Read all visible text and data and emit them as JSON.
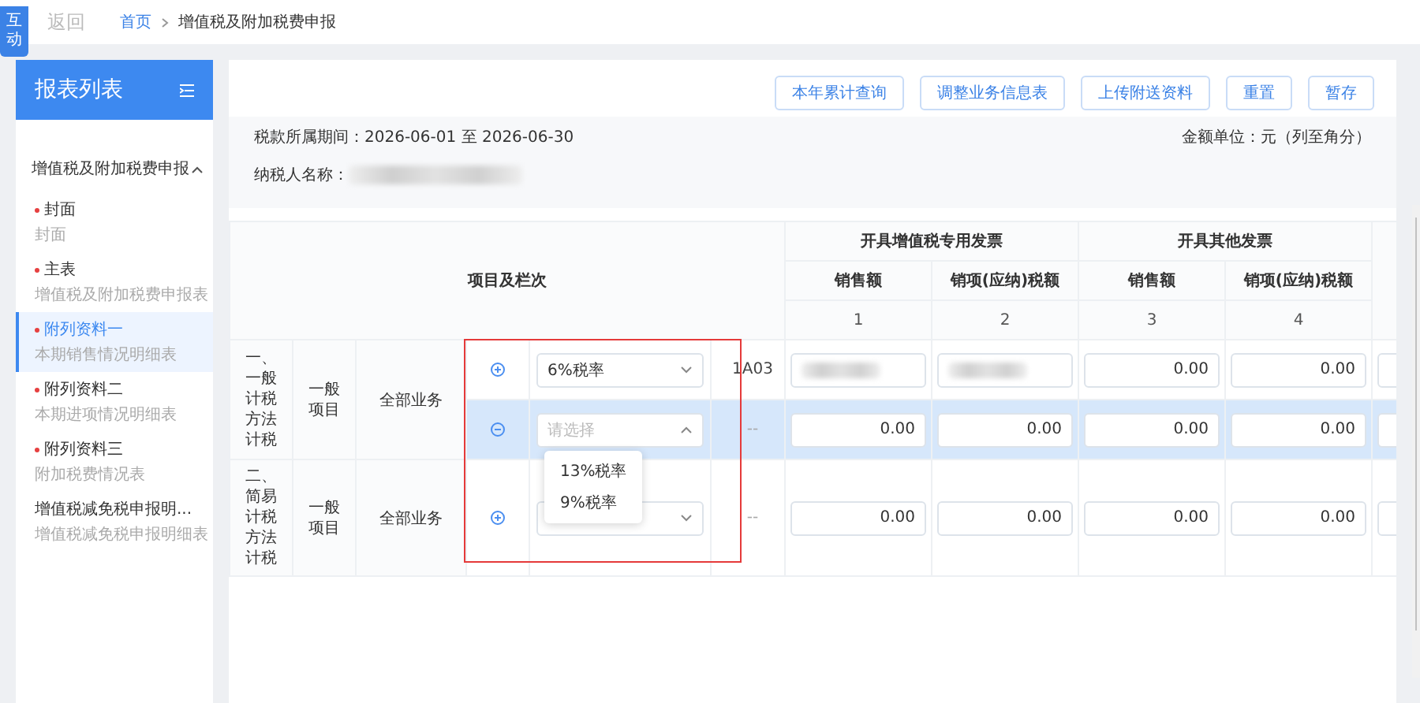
{
  "top_bar": {
    "badge": "互动",
    "back": "返回",
    "breadcrumb": [
      {
        "label": "首页",
        "link": true
      },
      {
        "label": "增值税及附加税费申报",
        "link": false
      }
    ]
  },
  "sidebar": {
    "title": "报表列表",
    "group": {
      "label": "增值税及附加税费申报",
      "expanded": true
    },
    "items": [
      {
        "title": "封面",
        "subtitle": "封面",
        "required": true,
        "selected": false
      },
      {
        "title": "主表",
        "subtitle": "增值税及附加税费申报表",
        "required": true,
        "selected": false
      },
      {
        "title": "附列资料一",
        "subtitle": "本期销售情况明细表",
        "required": true,
        "selected": true
      },
      {
        "title": "附列资料二",
        "subtitle": "本期进项情况明细表",
        "required": true,
        "selected": false
      },
      {
        "title": "附列资料三",
        "subtitle": "附加税费情况表",
        "required": true,
        "selected": false
      },
      {
        "title": "增值税减免税申报明...",
        "subtitle": "增值税减免税申报明细表",
        "required": false,
        "selected": false
      }
    ]
  },
  "toolbar": {
    "buttons": [
      "本年累计查询",
      "调整业务信息表",
      "上传附送资料",
      "重置",
      "暂存"
    ]
  },
  "info": {
    "period": "税款所属期间：2026-06-01 至 2026-06-30",
    "taxpayer_label": "纳税人名称：",
    "taxpayer_blurred": true,
    "unit": "金额单位：元（列至角分）"
  },
  "table": {
    "corner": "项目及栏次",
    "groups": [
      {
        "label": "开具增值税专用发票",
        "columns": [
          {
            "label": "销售额",
            "number": "1"
          },
          {
            "label": "销项(应纳)税额",
            "number": "2"
          }
        ]
      },
      {
        "label": "开具其他发票",
        "columns": [
          {
            "label": "销售额",
            "number": "3"
          },
          {
            "label": "销项(应纳)税额",
            "number": "4"
          }
        ]
      }
    ],
    "sections": [
      {
        "label": "一、一般计税方法计税",
        "item": "一般项目",
        "business": "全部业务",
        "rows": [
          {
            "kind": "add",
            "highlighted": false,
            "rate": {
              "value": "6%税率",
              "open": false
            },
            "code": "1A03",
            "cells": [
              {
                "blurred": true
              },
              {
                "blurred": true
              },
              {
                "value": "0.00",
                "blurred": false
              },
              {
                "value": "0.00",
                "blurred": false
              }
            ]
          },
          {
            "kind": "remove",
            "highlighted": true,
            "rate": {
              "placeholder": "请选择",
              "open": true
            },
            "code": "--",
            "cells": [
              {
                "value": "0.00",
                "blurred": false
              },
              {
                "value": "0.00",
                "blurred": false
              },
              {
                "value": "0.00",
                "blurred": false
              },
              {
                "value": "0.00",
                "blurred": false
              }
            ]
          }
        ]
      },
      {
        "label": "二、简易计税方法计税",
        "item": "一般项目",
        "business": "全部业务",
        "rows": [
          {
            "kind": "add",
            "highlighted": false,
            "rate": {
              "open": false
            },
            "code": "--",
            "cells": [
              {
                "value": "0.00",
                "blurred": false
              },
              {
                "value": "0.00",
                "blurred": false
              },
              {
                "value": "0.00",
                "blurred": false
              },
              {
                "value": "0.00",
                "blurred": false
              }
            ]
          }
        ]
      }
    ]
  },
  "dropdown": {
    "options": [
      {
        "label": "13%税率",
        "selected": false
      },
      {
        "label": "9%税率",
        "selected": false
      }
    ]
  }
}
